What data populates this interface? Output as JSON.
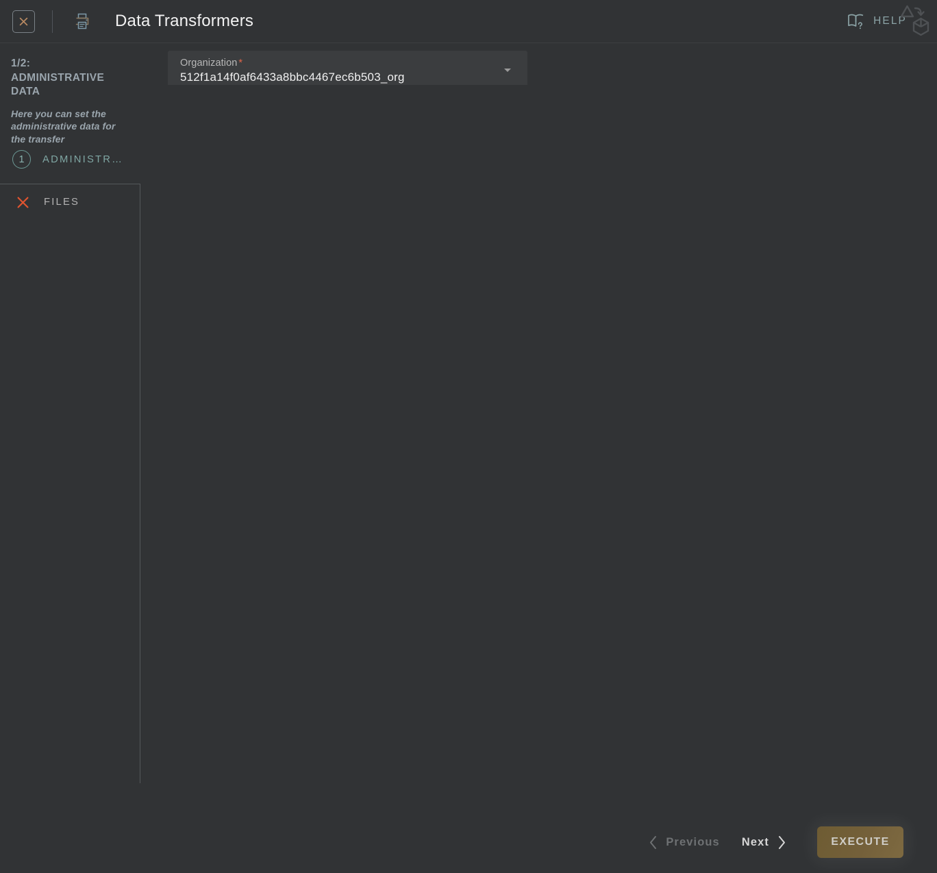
{
  "header": {
    "title": "Data Transformers",
    "close_icon": "close-x-box-icon",
    "print_icon": "printer-icon",
    "help_label": "HELP",
    "help_icon": "book-question-icon",
    "brand_icon": "triangle-to-cube-transform-icon"
  },
  "sidebar": {
    "step_counter": "1/2:",
    "step_title": "ADMINISTRATIVE DATA",
    "step_description": "Here you can set the administrative data for the transfer",
    "steps": [
      {
        "number": "1",
        "label": "ADMINISTR…"
      }
    ],
    "files": {
      "label": "FILES",
      "status_icon": "red-x-icon"
    }
  },
  "main": {
    "organization_field": {
      "label": "Organization",
      "required_mark": "*",
      "value": "512f1a14f0af6433a8bbc4467ec6b503_org",
      "caret_icon": "chevron-down-icon"
    }
  },
  "footer": {
    "previous_label": "Previous",
    "previous_icon": "chevron-left-icon",
    "next_label": "Next",
    "next_icon": "chevron-right-icon",
    "execute_label": "EXECUTE"
  },
  "colors": {
    "background": "#313335",
    "accent_teal": "#7fa6a3",
    "accent_red": "#e0654a",
    "execute_gold": "#74603a",
    "text_primary": "#f0f0f0",
    "text_muted": "#9aa5ad"
  }
}
